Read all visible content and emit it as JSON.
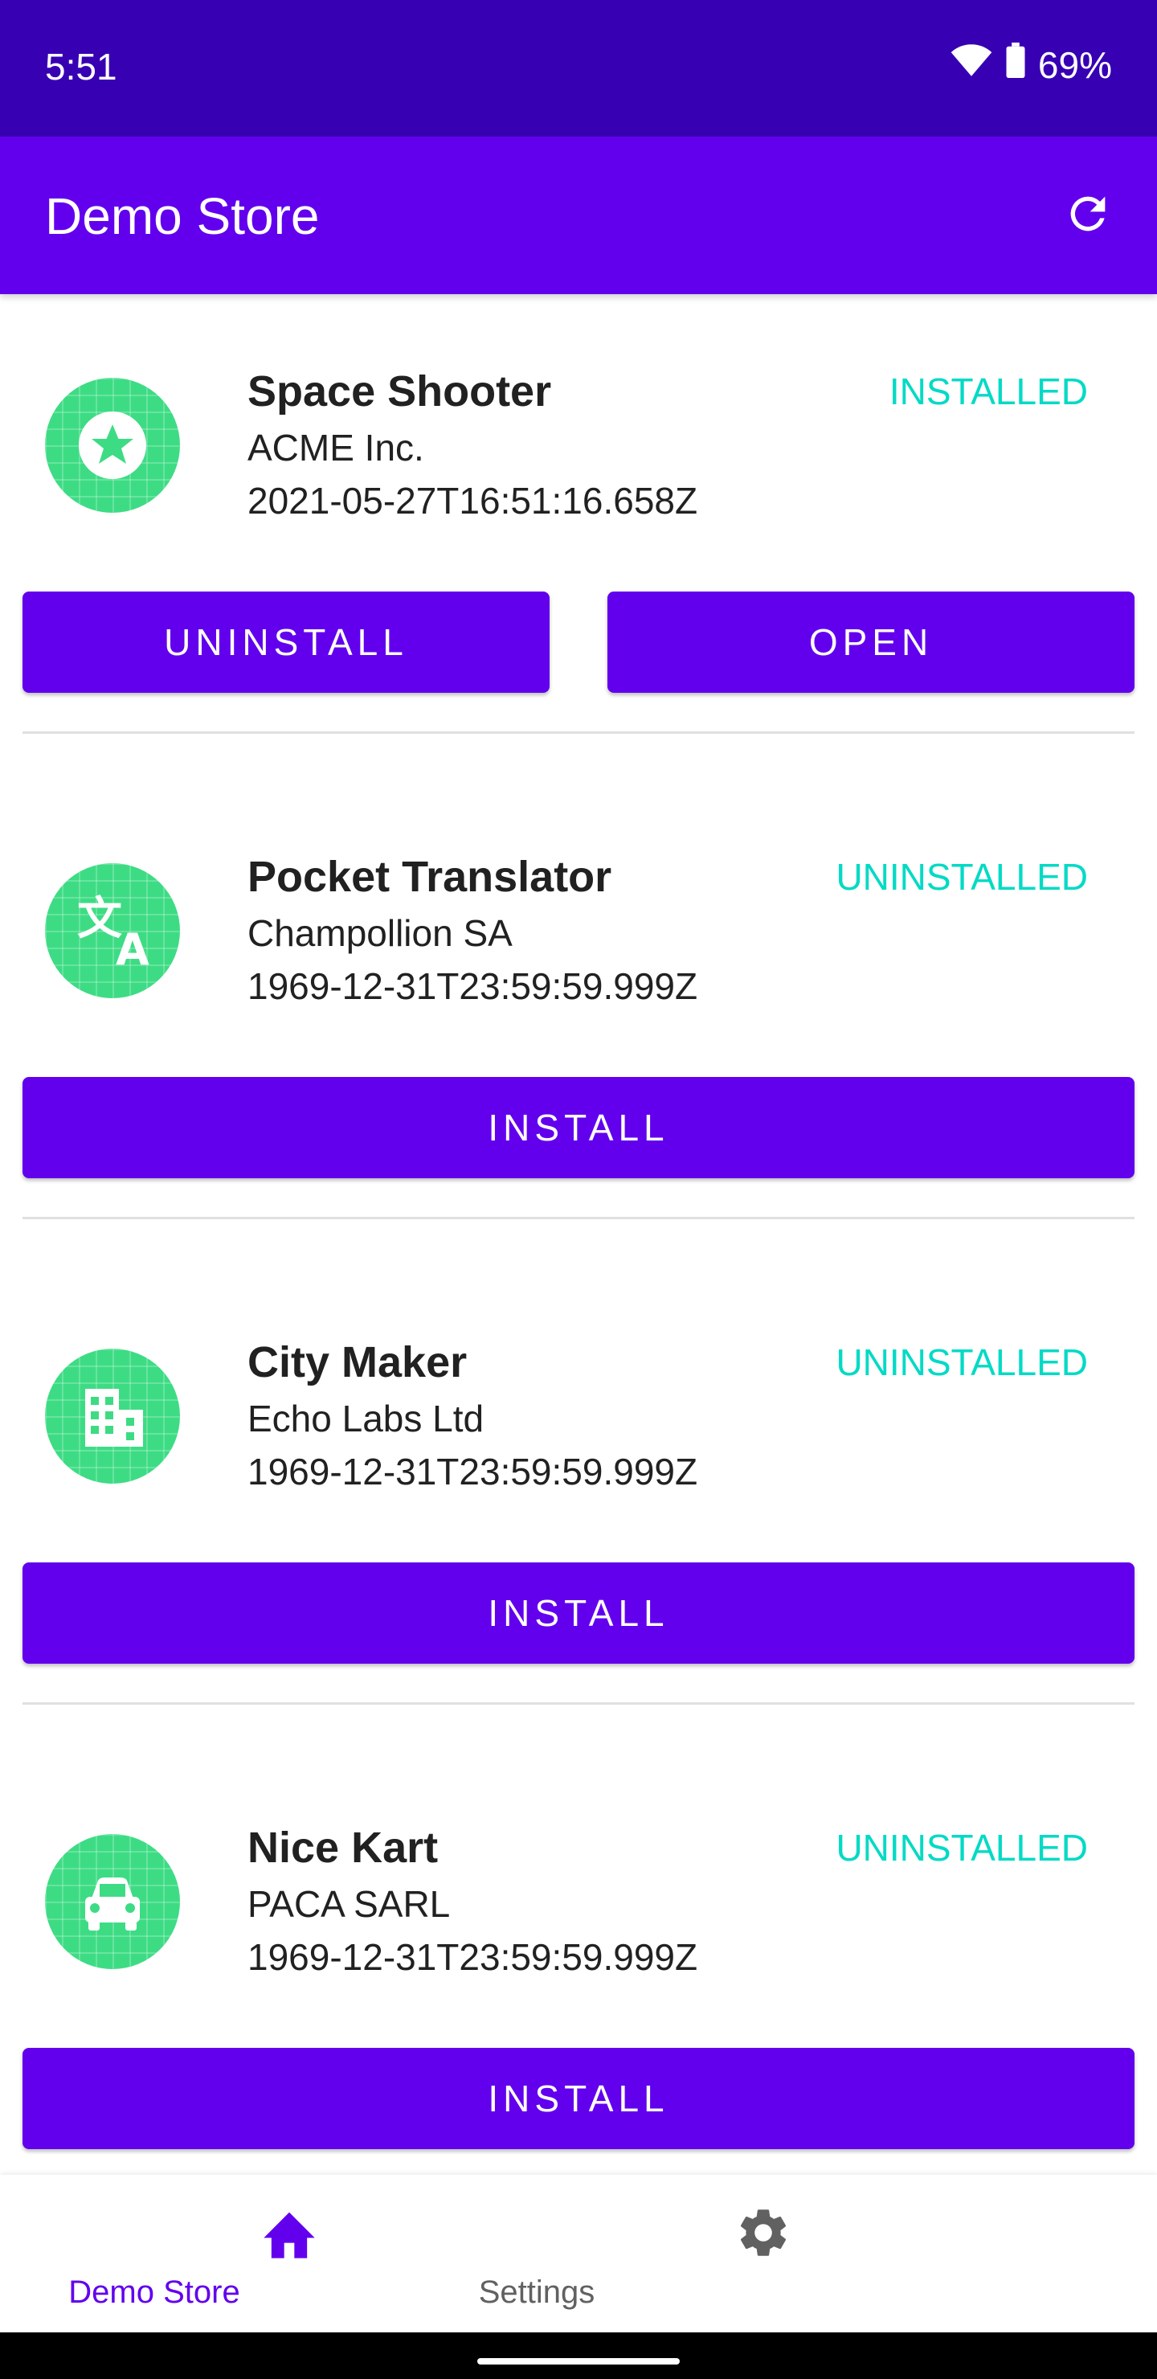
{
  "status_bar": {
    "time": "5:51",
    "battery": "69%",
    "icons": [
      "wifi-icon",
      "battery-icon"
    ]
  },
  "app_bar": {
    "title": "Demo Store",
    "action_icon": "refresh-icon"
  },
  "apps": [
    {
      "name": "Space Shooter",
      "developer": "ACME Inc.",
      "date": "2021-05-27T16:51:16.658Z",
      "status": "INSTALLED",
      "icon": "star-badge-icon",
      "buttons": [
        "UNINSTALL",
        "OPEN"
      ]
    },
    {
      "name": "Pocket Translator",
      "developer": "Champollion SA",
      "date": "1969-12-31T23:59:59.999Z",
      "status": "UNINSTALLED",
      "icon": "translate-icon",
      "buttons": [
        "INSTALL"
      ]
    },
    {
      "name": "City Maker",
      "developer": "Echo Labs Ltd",
      "date": "1969-12-31T23:59:59.999Z",
      "status": "UNINSTALLED",
      "icon": "city-icon",
      "buttons": [
        "INSTALL"
      ]
    },
    {
      "name": "Nice Kart",
      "developer": "PACA SARL",
      "date": "1969-12-31T23:59:59.999Z",
      "status": "UNINSTALLED",
      "icon": "car-icon",
      "buttons": [
        "INSTALL"
      ]
    }
  ],
  "bottom_nav": [
    {
      "label": "Demo Store",
      "icon": "home-icon",
      "active": true
    },
    {
      "label": "Settings",
      "icon": "gear-icon",
      "active": false
    }
  ],
  "colors": {
    "status_bar": "#3700b3",
    "primary": "#6200ee",
    "status_text": "#03dac5",
    "icon_background": "#3ddc84"
  }
}
